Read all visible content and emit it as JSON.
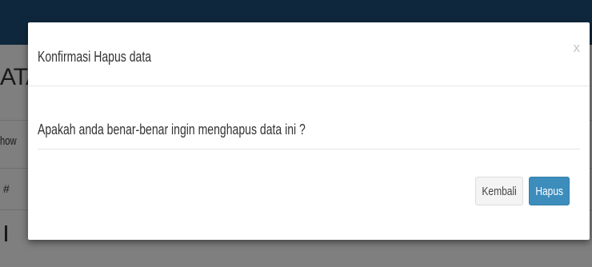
{
  "background": {
    "heading_fragment": "ATA",
    "show_fragment": "how",
    "row_marker": "#"
  },
  "modal": {
    "title": "Konfirmasi Hapus data",
    "close_label": "x",
    "message": "Apakah anda benar-benar ingin menghapus data ini ?",
    "cancel_label": "Kembali",
    "confirm_label": "Hapus"
  },
  "colors": {
    "primary": "#3c8dbc",
    "topbar": "#1f4f78",
    "backdrop": "rgba(0,0,0,0.5)"
  }
}
